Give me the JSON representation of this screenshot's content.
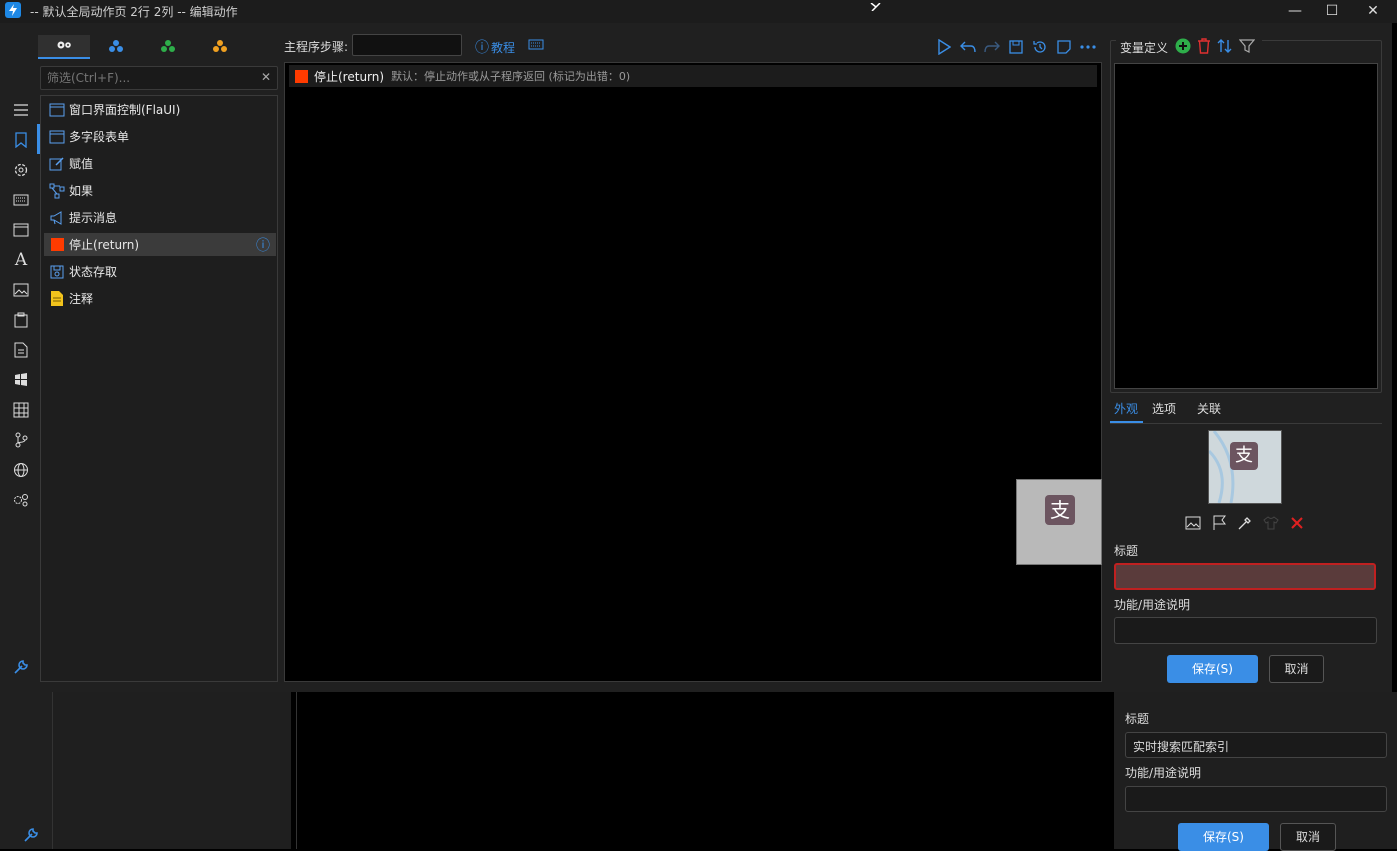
{
  "window": {
    "title": "-- 默认全局动作页 2行 2列 -- 编辑动作",
    "minimize": "—",
    "maximize": "☐",
    "close": "✕"
  },
  "left_tabs": [
    "gears-icon",
    "cluster-blue-icon",
    "cluster-green-icon",
    "cluster-orange-icon"
  ],
  "filter": {
    "placeholder": "筛选(Ctrl+F)...",
    "clear": "✕"
  },
  "actions": [
    {
      "label": "窗口界面控制(FlaUI)",
      "icon": "window-icon"
    },
    {
      "label": "多字段表单",
      "icon": "form-icon"
    },
    {
      "label": "赋值",
      "icon": "edit-icon"
    },
    {
      "label": "如果",
      "icon": "branch-icon"
    },
    {
      "label": "提示消息",
      "icon": "megaphone-icon"
    },
    {
      "label": "停止(return)",
      "icon": "stop-icon",
      "selected": true,
      "info": "ⓘ"
    },
    {
      "label": "状态存取",
      "icon": "save-icon"
    },
    {
      "label": "注释",
      "icon": "note-icon"
    }
  ],
  "toolbar": {
    "steps_label": "主程序步骤:",
    "steps_value": "",
    "tutorial": "教程"
  },
  "step": {
    "name": "停止(return)",
    "desc": "默认：停止动作或从子程序返回 (标记为出错：0)"
  },
  "right": {
    "var_title": "变量定义",
    "tabs": [
      "外观",
      "选项",
      "关联"
    ],
    "title_label": "标题",
    "title_value": "",
    "desc_label": "功能/用途说明",
    "desc_value": "",
    "save": "保存(S)",
    "cancel": "取消",
    "logo_char": "支"
  },
  "background": {
    "title_label": "标题",
    "title_value": "实时搜索匹配索引",
    "desc_label": "功能/用途说明",
    "save": "保存(S)",
    "cancel": "取消"
  },
  "colors": {
    "accent": "#3a8ee6",
    "stop_red": "#ff3b00",
    "title_invalid_bg": "#5a3b3b",
    "title_invalid_border": "#c02020"
  }
}
